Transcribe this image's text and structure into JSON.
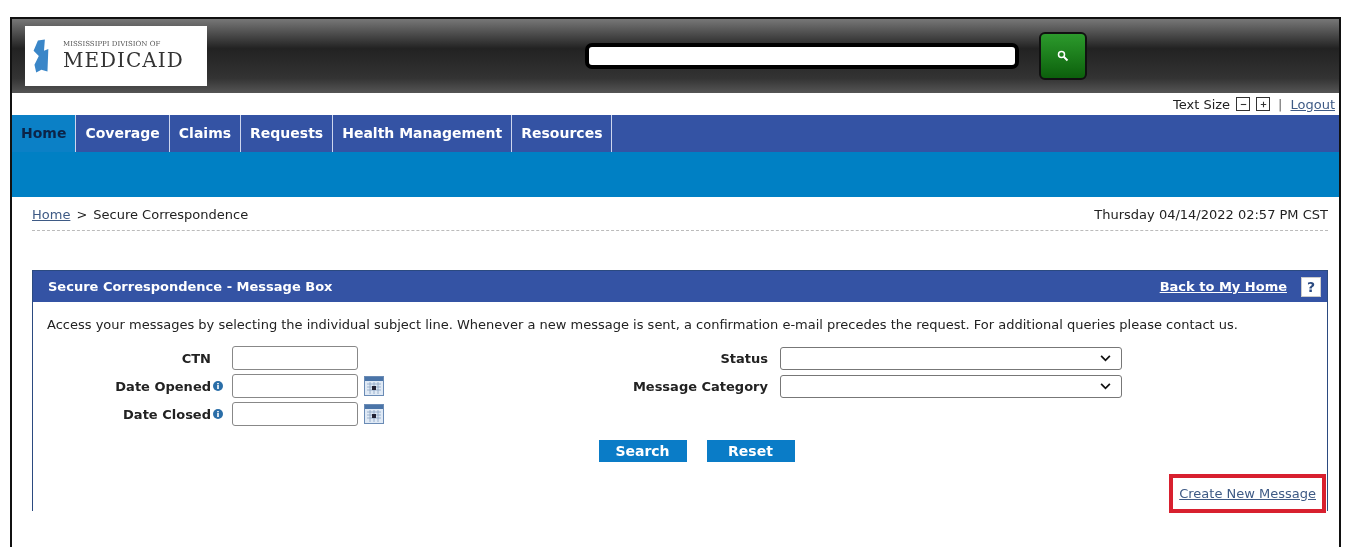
{
  "header": {
    "logo": {
      "top_line": "MISSISSIPPI DIVISION OF",
      "name": "MEDICAID"
    }
  },
  "utility_bar": {
    "text_size_label": "Text Size",
    "separator": "|",
    "logout": "Logout"
  },
  "nav_tabs": [
    {
      "label": "Home",
      "selected": true
    },
    {
      "label": "Coverage",
      "selected": false
    },
    {
      "label": "Claims",
      "selected": false
    },
    {
      "label": "Requests",
      "selected": false
    },
    {
      "label": "Health Management",
      "selected": false
    },
    {
      "label": "Resources",
      "selected": false
    }
  ],
  "breadcrumb": {
    "link": "Home",
    "separator": ">",
    "current": "Secure Correspondence"
  },
  "datetime": "Thursday 04/14/2022 02:57 PM CST",
  "panel": {
    "title": "Secure Correspondence - Message Box",
    "back_link": "Back to My Home",
    "help": "?",
    "description": "Access your messages by selecting the individual subject line. Whenever a new message is sent, a confirmation e-mail precedes the request. For additional queries please contact us.",
    "left_fields": [
      {
        "label": "CTN",
        "kind": "text",
        "info": false
      },
      {
        "label": "Date Opened",
        "kind": "date",
        "info": true
      },
      {
        "label": "Date Closed",
        "kind": "date",
        "info": true
      }
    ],
    "right_fields": [
      {
        "label": "Status",
        "kind": "select"
      },
      {
        "label": "Message Category",
        "kind": "select"
      }
    ],
    "buttons": [
      "Search",
      "Reset"
    ],
    "create_link": {
      "label": "Create New Message",
      "highlighted": true
    }
  }
}
